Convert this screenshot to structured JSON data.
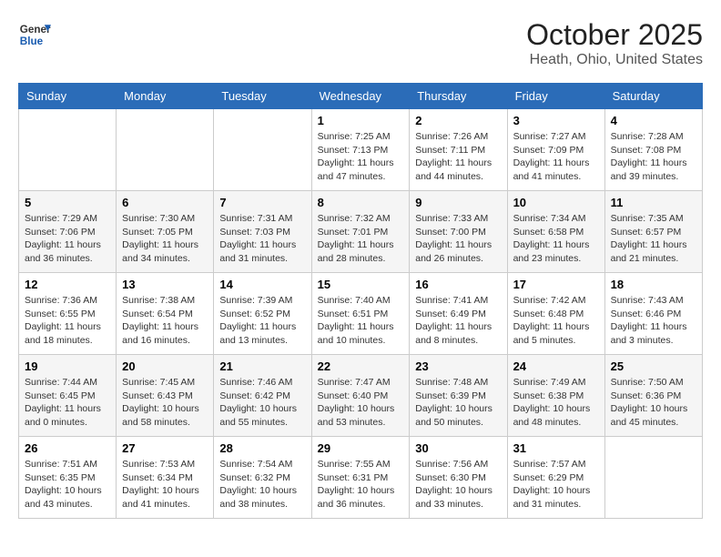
{
  "header": {
    "logo_line1": "General",
    "logo_line2": "Blue",
    "month": "October 2025",
    "location": "Heath, Ohio, United States"
  },
  "days_of_week": [
    "Sunday",
    "Monday",
    "Tuesday",
    "Wednesday",
    "Thursday",
    "Friday",
    "Saturday"
  ],
  "weeks": [
    [
      {
        "day": "",
        "info": ""
      },
      {
        "day": "",
        "info": ""
      },
      {
        "day": "",
        "info": ""
      },
      {
        "day": "1",
        "info": "Sunrise: 7:25 AM\nSunset: 7:13 PM\nDaylight: 11 hours and 47 minutes."
      },
      {
        "day": "2",
        "info": "Sunrise: 7:26 AM\nSunset: 7:11 PM\nDaylight: 11 hours and 44 minutes."
      },
      {
        "day": "3",
        "info": "Sunrise: 7:27 AM\nSunset: 7:09 PM\nDaylight: 11 hours and 41 minutes."
      },
      {
        "day": "4",
        "info": "Sunrise: 7:28 AM\nSunset: 7:08 PM\nDaylight: 11 hours and 39 minutes."
      }
    ],
    [
      {
        "day": "5",
        "info": "Sunrise: 7:29 AM\nSunset: 7:06 PM\nDaylight: 11 hours and 36 minutes."
      },
      {
        "day": "6",
        "info": "Sunrise: 7:30 AM\nSunset: 7:05 PM\nDaylight: 11 hours and 34 minutes."
      },
      {
        "day": "7",
        "info": "Sunrise: 7:31 AM\nSunset: 7:03 PM\nDaylight: 11 hours and 31 minutes."
      },
      {
        "day": "8",
        "info": "Sunrise: 7:32 AM\nSunset: 7:01 PM\nDaylight: 11 hours and 28 minutes."
      },
      {
        "day": "9",
        "info": "Sunrise: 7:33 AM\nSunset: 7:00 PM\nDaylight: 11 hours and 26 minutes."
      },
      {
        "day": "10",
        "info": "Sunrise: 7:34 AM\nSunset: 6:58 PM\nDaylight: 11 hours and 23 minutes."
      },
      {
        "day": "11",
        "info": "Sunrise: 7:35 AM\nSunset: 6:57 PM\nDaylight: 11 hours and 21 minutes."
      }
    ],
    [
      {
        "day": "12",
        "info": "Sunrise: 7:36 AM\nSunset: 6:55 PM\nDaylight: 11 hours and 18 minutes."
      },
      {
        "day": "13",
        "info": "Sunrise: 7:38 AM\nSunset: 6:54 PM\nDaylight: 11 hours and 16 minutes."
      },
      {
        "day": "14",
        "info": "Sunrise: 7:39 AM\nSunset: 6:52 PM\nDaylight: 11 hours and 13 minutes."
      },
      {
        "day": "15",
        "info": "Sunrise: 7:40 AM\nSunset: 6:51 PM\nDaylight: 11 hours and 10 minutes."
      },
      {
        "day": "16",
        "info": "Sunrise: 7:41 AM\nSunset: 6:49 PM\nDaylight: 11 hours and 8 minutes."
      },
      {
        "day": "17",
        "info": "Sunrise: 7:42 AM\nSunset: 6:48 PM\nDaylight: 11 hours and 5 minutes."
      },
      {
        "day": "18",
        "info": "Sunrise: 7:43 AM\nSunset: 6:46 PM\nDaylight: 11 hours and 3 minutes."
      }
    ],
    [
      {
        "day": "19",
        "info": "Sunrise: 7:44 AM\nSunset: 6:45 PM\nDaylight: 11 hours and 0 minutes."
      },
      {
        "day": "20",
        "info": "Sunrise: 7:45 AM\nSunset: 6:43 PM\nDaylight: 10 hours and 58 minutes."
      },
      {
        "day": "21",
        "info": "Sunrise: 7:46 AM\nSunset: 6:42 PM\nDaylight: 10 hours and 55 minutes."
      },
      {
        "day": "22",
        "info": "Sunrise: 7:47 AM\nSunset: 6:40 PM\nDaylight: 10 hours and 53 minutes."
      },
      {
        "day": "23",
        "info": "Sunrise: 7:48 AM\nSunset: 6:39 PM\nDaylight: 10 hours and 50 minutes."
      },
      {
        "day": "24",
        "info": "Sunrise: 7:49 AM\nSunset: 6:38 PM\nDaylight: 10 hours and 48 minutes."
      },
      {
        "day": "25",
        "info": "Sunrise: 7:50 AM\nSunset: 6:36 PM\nDaylight: 10 hours and 45 minutes."
      }
    ],
    [
      {
        "day": "26",
        "info": "Sunrise: 7:51 AM\nSunset: 6:35 PM\nDaylight: 10 hours and 43 minutes."
      },
      {
        "day": "27",
        "info": "Sunrise: 7:53 AM\nSunset: 6:34 PM\nDaylight: 10 hours and 41 minutes."
      },
      {
        "day": "28",
        "info": "Sunrise: 7:54 AM\nSunset: 6:32 PM\nDaylight: 10 hours and 38 minutes."
      },
      {
        "day": "29",
        "info": "Sunrise: 7:55 AM\nSunset: 6:31 PM\nDaylight: 10 hours and 36 minutes."
      },
      {
        "day": "30",
        "info": "Sunrise: 7:56 AM\nSunset: 6:30 PM\nDaylight: 10 hours and 33 minutes."
      },
      {
        "day": "31",
        "info": "Sunrise: 7:57 AM\nSunset: 6:29 PM\nDaylight: 10 hours and 31 minutes."
      },
      {
        "day": "",
        "info": ""
      }
    ]
  ]
}
